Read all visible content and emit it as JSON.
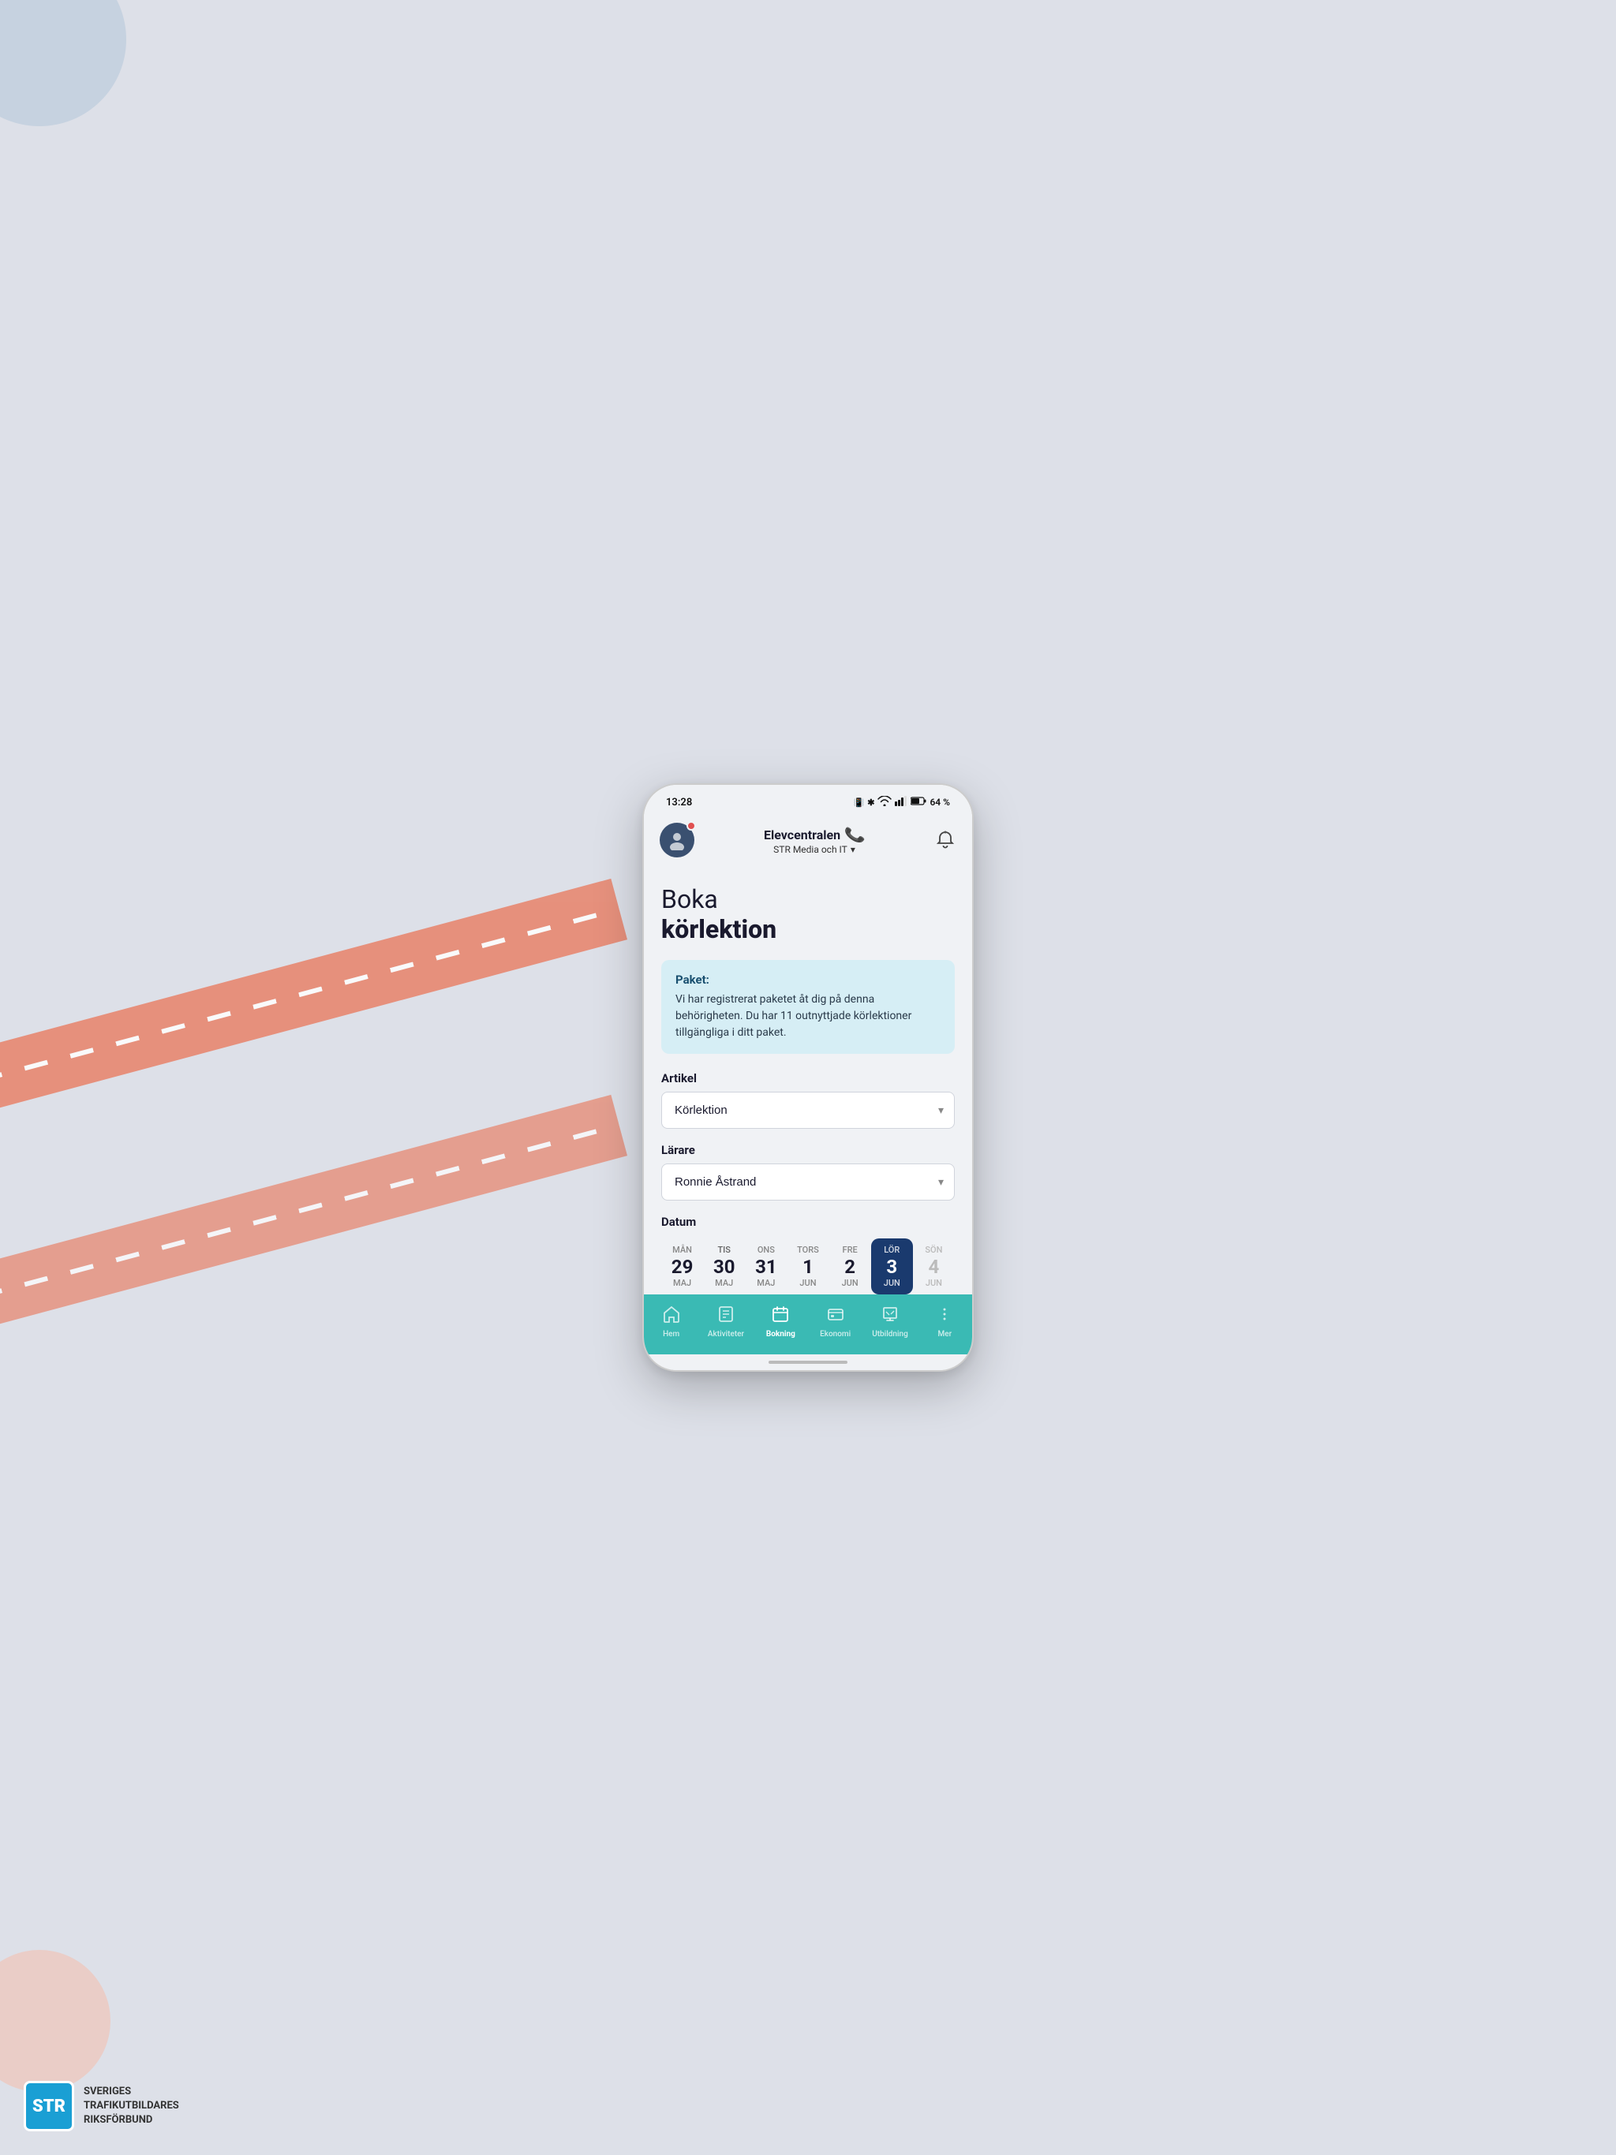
{
  "page": {
    "background_color": "#dde0e8"
  },
  "status_bar": {
    "time": "13:28",
    "battery": "64 %",
    "icons": "🔔 🔵 📶 📶 🔋"
  },
  "header": {
    "brand_name": "Elevcentralen",
    "sub_title": "STR Media och IT",
    "chevron": "▾"
  },
  "page_title": {
    "line1": "Boka",
    "line2": "körlektion"
  },
  "info_box": {
    "title": "Paket:",
    "text": "Vi har registrerat paketet åt dig på denna behörigheten. Du har 11 outnyttjade körlektioner tillgängliga i ditt paket."
  },
  "artikel": {
    "label": "Artikel",
    "value": "Körlektion",
    "placeholder": "Körlektion"
  },
  "larare": {
    "label": "Lärare",
    "value": "Ronnie Åstrand",
    "placeholder": "Ronnie Åstrand"
  },
  "datum": {
    "label": "Datum",
    "days": [
      {
        "day_name": "MÅN",
        "day_num": "29",
        "month": "MAJ",
        "state": "normal"
      },
      {
        "day_name": "TIS",
        "day_num": "30",
        "month": "MAJ",
        "state": "today"
      },
      {
        "day_name": "ONS",
        "day_num": "31",
        "month": "MAJ",
        "state": "normal"
      },
      {
        "day_name": "TORS",
        "day_num": "1",
        "month": "JUN",
        "state": "normal"
      },
      {
        "day_name": "FRE",
        "day_num": "2",
        "month": "JUN",
        "state": "normal"
      },
      {
        "day_name": "LÖR",
        "day_num": "3",
        "month": "JUN",
        "state": "active"
      },
      {
        "day_name": "SÖN",
        "day_num": "4",
        "month": "JUN",
        "state": "dimmed"
      }
    ]
  },
  "bottom_nav": {
    "items": [
      {
        "label": "Hem",
        "icon": "⌂",
        "active": false
      },
      {
        "label": "Aktiviteter",
        "icon": "📋",
        "active": false
      },
      {
        "label": "Bokning",
        "icon": "📅",
        "active": true
      },
      {
        "label": "Ekonomi",
        "icon": "💳",
        "active": false
      },
      {
        "label": "Utbildning",
        "icon": "📊",
        "active": false
      },
      {
        "label": "Mer",
        "icon": "⋮",
        "active": false
      }
    ]
  },
  "str_logo": {
    "abbr": "STR",
    "line1": "SVERIGES",
    "line2": "TRAFIKUTBILDARES",
    "line3": "RIKSFÖRBUND"
  }
}
